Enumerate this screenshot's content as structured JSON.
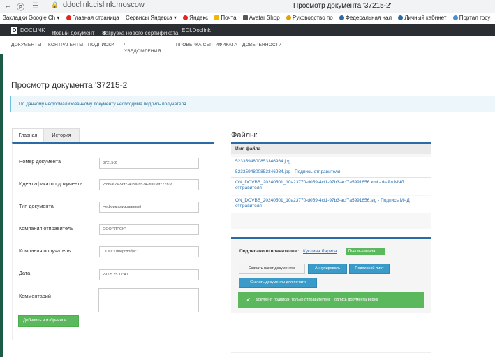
{
  "browser": {
    "url": "ddoclink.cislink.moscow",
    "window_title": "Просмотр документа '37215-2'",
    "bookmarks": [
      "Закладки Google Ch",
      "Главная страница",
      "Сервисы Яндекса",
      "Яндекс",
      "Почта",
      "Avatar Shop",
      "Руководство по",
      "Федеральная нал",
      "Личный кабинет",
      "Портал госу"
    ]
  },
  "app": {
    "brand": "DOCLINK",
    "actions": [
      "Новый документ",
      "Загрузка нового сертификата",
      "EDI.Doclink"
    ],
    "nav": [
      "ДОКУМЕНТЫ",
      "КОНТРАГЕНТЫ",
      "ПОДПИСКИ",
      "УВЕДОМЛЕНИЯ",
      "ПРОВЕРКА СЕРТИФИКАТА",
      "ДОВЕРЕННОСТИ"
    ],
    "notifications_count": "0"
  },
  "page": {
    "title": "Просмотр документа '37215-2'",
    "notice": "По данному неформализованному документу необходима подпись получателя"
  },
  "tabs": [
    "Главная",
    "История"
  ],
  "form": {
    "fields": [
      {
        "label": "Номер документа",
        "value": "37215-2"
      },
      {
        "label": "Идентификатор документа",
        "value": "2895af24-56f7-405a-b574-d003df777b3c"
      },
      {
        "label": "Тип документа",
        "value": "Неформализованный"
      },
      {
        "label": "Компания отправитель",
        "value": "ООО \"ЯРСК\""
      },
      {
        "label": "Компания получатель",
        "value": "ООО \"Гиперглобус\""
      },
      {
        "label": "Дата",
        "value": "29.05.25 17:41"
      }
    ],
    "comment_label": "Комментарий",
    "add_favorite": "Добавить в избранное"
  },
  "files": {
    "title": "Файлы:",
    "header": "Имя файла",
    "rows": [
      "5233594800853346984.jpg",
      "5233594800853346984.jpg - Подпись отправителя",
      "ON_DOVBB_20240501_10a23770-d059-4cf1-97b3-acf7a5991656.xml - Файл МЧД отправителя",
      "ON_DOVBB_20240501_10a23770-d059-4cf1-97b3-acf7a5991656.sig - Подпись МЧД отправителя"
    ]
  },
  "signature": {
    "label": "Подписано отправителем:",
    "signer": "Куклина Лариса",
    "badge": "Подпись верна",
    "buttons": {
      "download": "Скачать пакет документов",
      "annul": "Аннулировать",
      "sheet": "Подписной лист",
      "print": "Скачать документы для печати"
    },
    "status": "Документ подписан только отправителем. Подпись документа верна"
  },
  "colors": {
    "accent": "#2b6aa6",
    "success": "#5cb85c",
    "info": "#3a9bc9",
    "appbar": "#2b2f33"
  }
}
